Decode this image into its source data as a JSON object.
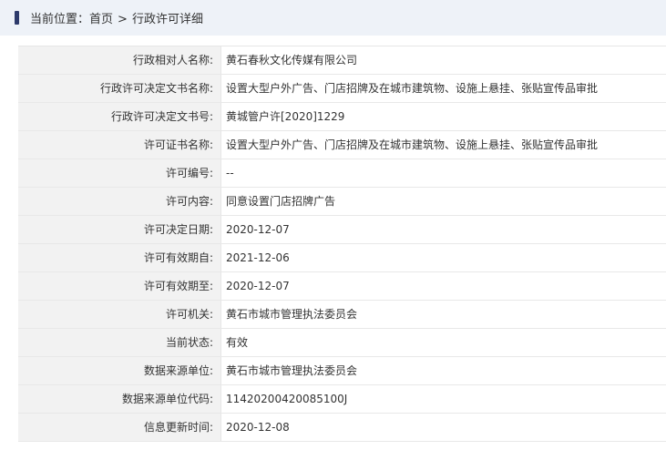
{
  "breadcrumb": {
    "prefix": "当前位置：",
    "home": "首页",
    "separator": ">",
    "current": "行政许可详细"
  },
  "rows": [
    {
      "label": "行政相对人名称:",
      "value": "黄石春秋文化传媒有限公司"
    },
    {
      "label": "行政许可决定文书名称:",
      "value": "设置大型户外广告、门店招牌及在城市建筑物、设施上悬挂、张贴宣传品审批"
    },
    {
      "label": "行政许可决定文书号:",
      "value": "黄城管户许[2020]1229"
    },
    {
      "label": "许可证书名称:",
      "value": "设置大型户外广告、门店招牌及在城市建筑物、设施上悬挂、张贴宣传品审批"
    },
    {
      "label": "许可编号:",
      "value": "--"
    },
    {
      "label": "许可内容:",
      "value": "同意设置门店招牌广告"
    },
    {
      "label": "许可决定日期:",
      "value": "2020-12-07"
    },
    {
      "label": "许可有效期自:",
      "value": "2021-12-06"
    },
    {
      "label": "许可有效期至:",
      "value": "2020-12-07"
    },
    {
      "label": "许可机关:",
      "value": "黄石市城市管理执法委员会"
    },
    {
      "label": "当前状态:",
      "value": "有效"
    },
    {
      "label": "数据来源单位:",
      "value": "黄石市城市管理执法委员会"
    },
    {
      "label": "数据来源单位代码:",
      "value": "11420200420085100J"
    },
    {
      "label": "信息更新时间:",
      "value": "2020-12-08"
    }
  ]
}
